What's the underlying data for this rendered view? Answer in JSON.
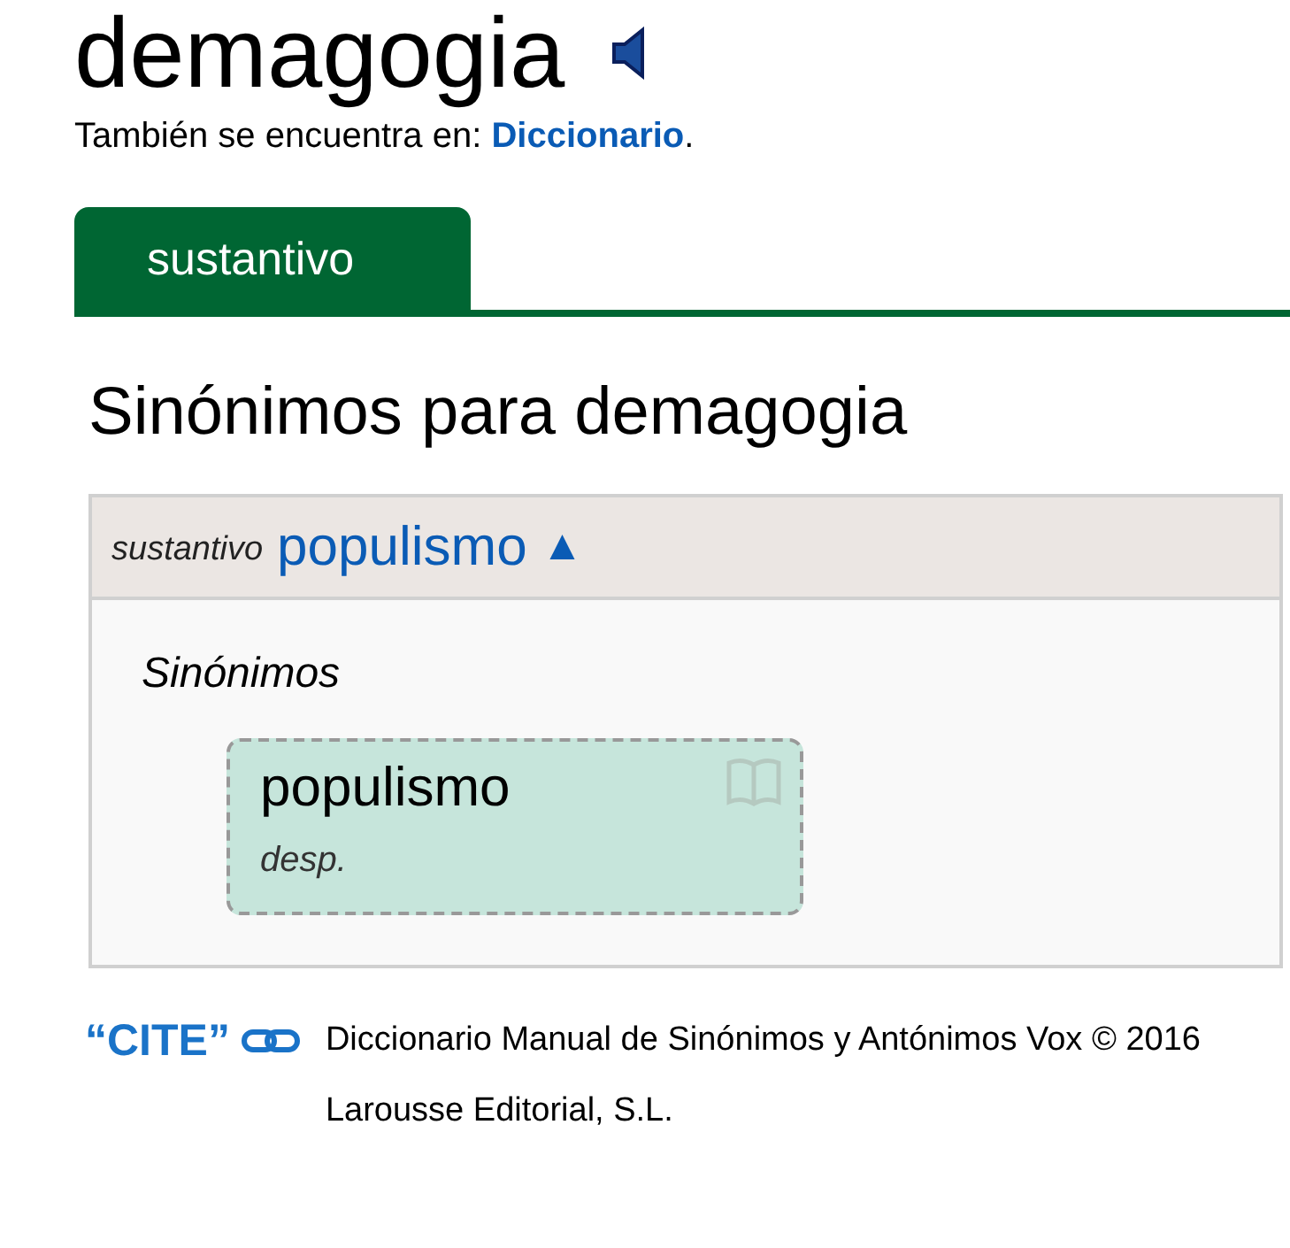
{
  "headword": {
    "title": "demagogia"
  },
  "also_found": {
    "text": "También se encuentra en: ",
    "link": "Diccionario",
    "end": "."
  },
  "tabs": [
    {
      "label": "sustantivo",
      "selected": true
    }
  ],
  "section_title": "Sinónimos para demagogia",
  "groups": [
    {
      "pos": "sustantivo",
      "word": "populismo",
      "toggle": "▲",
      "expanded": true,
      "subheading": "Sinónimos",
      "cards": [
        {
          "word": "populismo",
          "note": "desp."
        }
      ]
    }
  ],
  "footer": {
    "cite": "“CITE”",
    "text": "Diccionario Manual de Sinónimos y Antónimos Vox © 2016 Larousse Editorial, S.L."
  }
}
